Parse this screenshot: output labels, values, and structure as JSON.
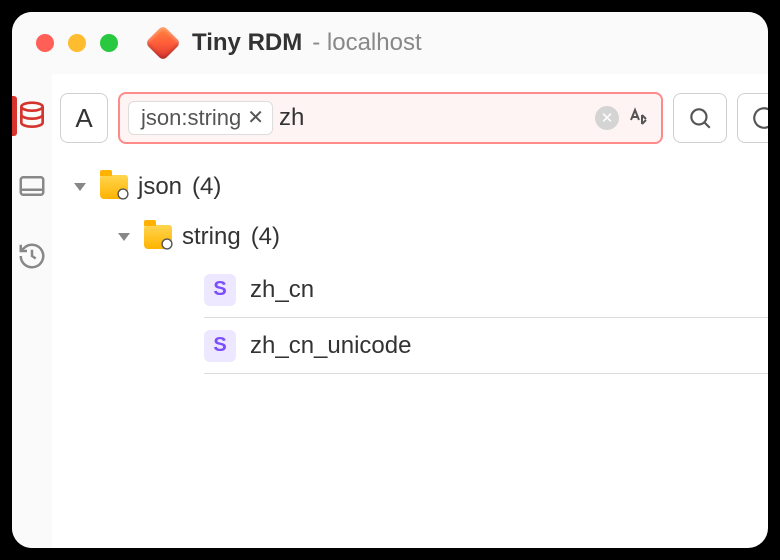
{
  "window": {
    "app_name": "Tiny RDM",
    "connection": "- localhost"
  },
  "sidebar": {
    "items": [
      {
        "name": "database",
        "active": true
      },
      {
        "name": "server",
        "active": false
      },
      {
        "name": "history",
        "active": false
      }
    ]
  },
  "toolbar": {
    "case_label": "A",
    "filter_tag": "json:string",
    "search_value": "zh"
  },
  "tree": {
    "root": {
      "label": "json",
      "count": "(4)",
      "children": [
        {
          "label": "string",
          "count": "(4)",
          "keys": [
            {
              "type": "S",
              "name": "zh_cn"
            },
            {
              "type": "S",
              "name": "zh_cn_unicode"
            }
          ]
        }
      ]
    }
  }
}
